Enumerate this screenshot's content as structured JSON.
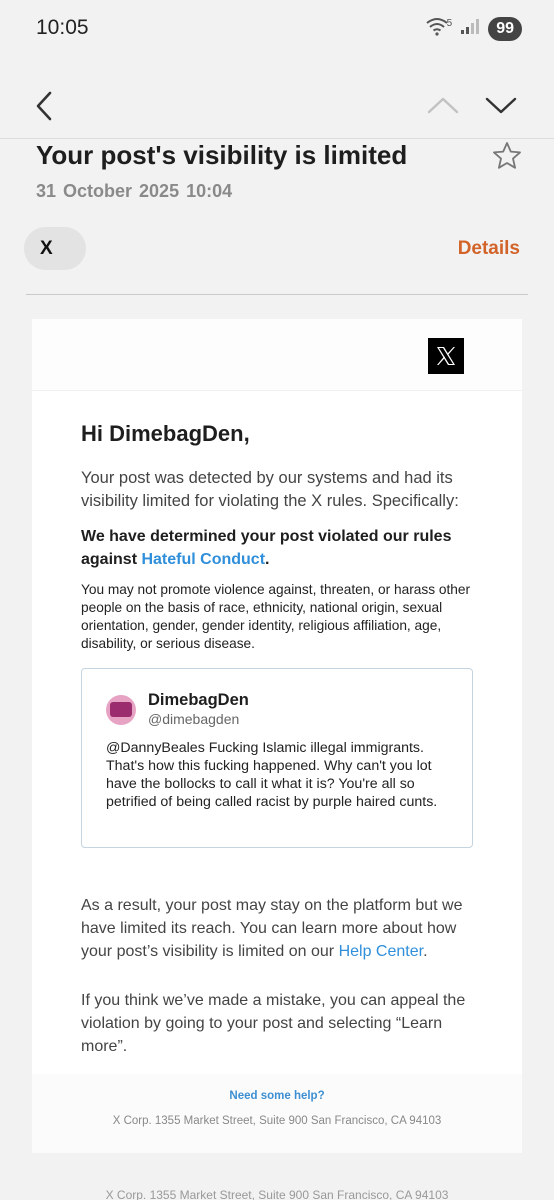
{
  "status_bar": {
    "time": "10:05",
    "signal_label": "5",
    "battery": "99"
  },
  "email": {
    "subject": "Your post's visibility is limited",
    "date": "31 October 2025  10:04",
    "sender_name": "X",
    "details_label": "Details"
  },
  "body": {
    "logo": "𝕏",
    "greeting": "Hi DimebagDen,",
    "intro": "Your post was detected by our systems and had its visibility limited for violating the X rules. Specifically:",
    "rule_prefix": "We have determined your post violated our rules against ",
    "rule_link": "Hateful Conduct",
    "rule_suffix": ".",
    "rule_description": "You may not promote violence against, threaten, or harass other people on the basis of race, ethnicity, national origin, sexual orientation, gender, gender identity, religious affiliation, age, disability, or serious disease.",
    "tweet": {
      "name": "DimebagDen",
      "handle": "@dimebagden",
      "text": "@DannyBeales Fucking Islamic illegal immigrants. That's how this fucking happened. Why can't you lot have the bollocks to call it what it is? You're all so petrified of being called racist by purple haired cunts."
    },
    "result_prefix": "As a result, your post may stay on the platform but we have limited its reach. You can learn more about how your post’s visibility is limited on our ",
    "result_link": "Help Center",
    "result_suffix": ".",
    "appeal": "If you think we’ve made a mistake, you can appeal the violation by going to your post and selecting “Learn more”."
  },
  "footer": {
    "help": "Need some help?",
    "address": "X Corp. 1355 Market Street, Suite 900 San Francisco, CA 94103"
  },
  "colors": {
    "accent_orange": "#d2642a",
    "link_blue": "#2f8fdb"
  },
  "icons": [
    "wifi-icon",
    "signal-icon",
    "back-icon",
    "chevron-up-icon",
    "chevron-down-icon",
    "star-icon",
    "x-logo-icon"
  ]
}
